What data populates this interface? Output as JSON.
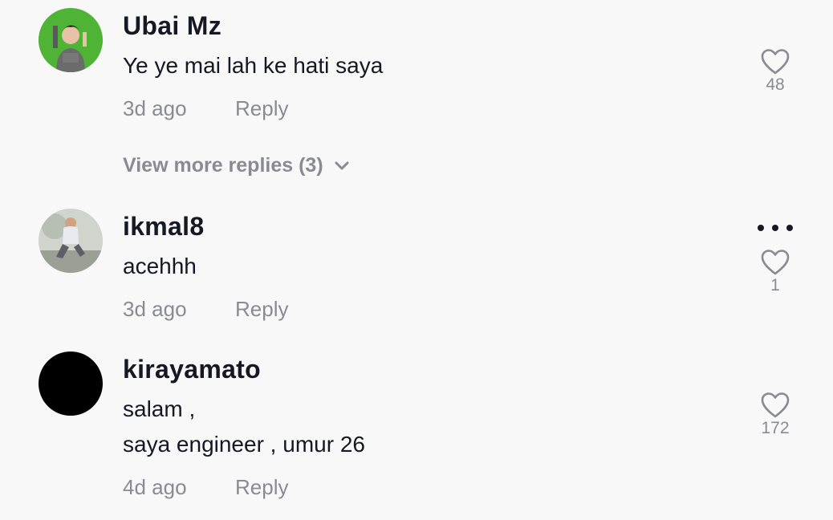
{
  "comments": [
    {
      "username": "Ubai Mz",
      "text_lines": [
        "Ye ye mai lah ke hati saya"
      ],
      "time": "3d ago",
      "reply_label": "Reply",
      "likes": "48",
      "avatar_icon": "user-avatar-green"
    },
    {
      "username": "ikmal8",
      "text_lines": [
        "acehhh"
      ],
      "time": "3d ago",
      "reply_label": "Reply",
      "likes": "1",
      "avatar_icon": "user-avatar-photo"
    },
    {
      "username": "kirayamato",
      "text_lines": [
        "salam ,",
        "saya engineer , umur 26"
      ],
      "time": "4d ago",
      "reply_label": "Reply",
      "likes": "172",
      "avatar_icon": "user-avatar-black"
    }
  ],
  "view_more_replies": "View more replies (3)",
  "icons": {
    "like": "heart-outline-icon",
    "expand": "chevron-down-icon",
    "more": "more-options-icon"
  },
  "colors": {
    "background": "#f8f8f8",
    "primary_text": "#161823",
    "secondary_text": "#8a8b91",
    "icon_gray": "#8a8b91"
  }
}
